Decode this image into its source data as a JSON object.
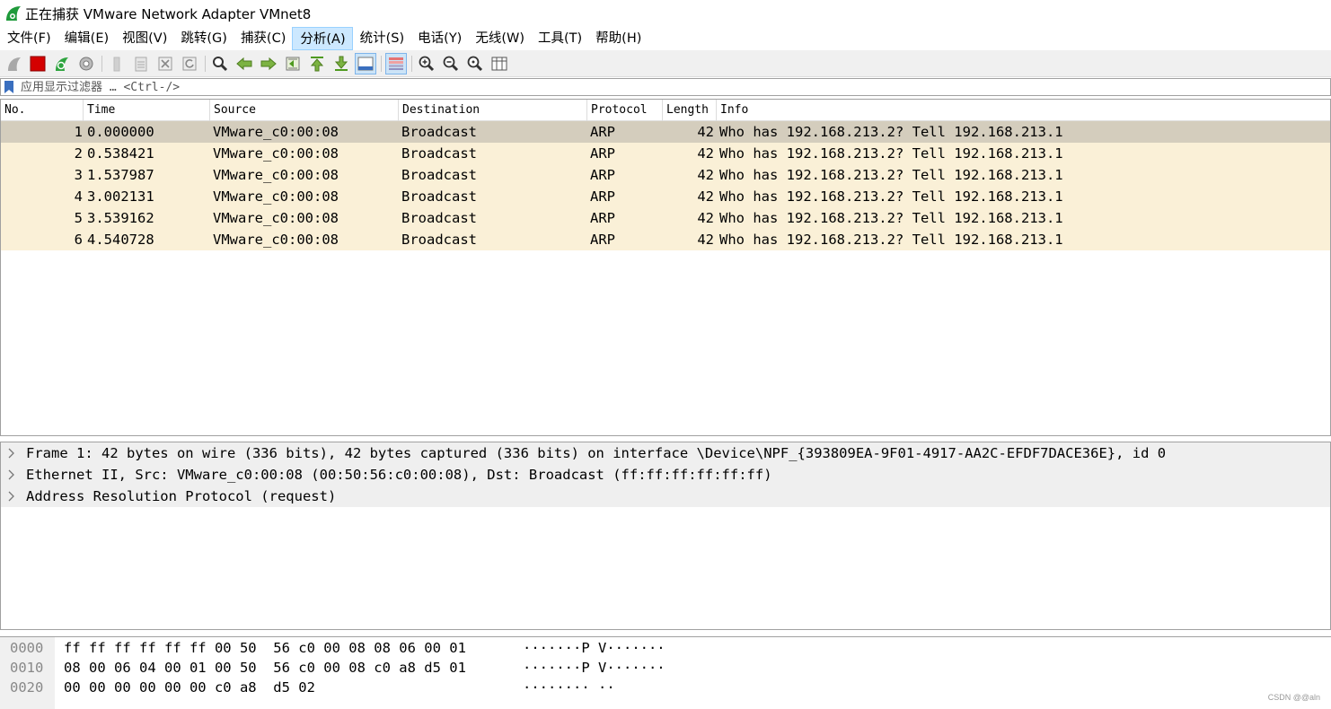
{
  "window": {
    "title": "正在捕获 VMware Network Adapter VMnet8"
  },
  "menu": [
    {
      "label": "文件(F)"
    },
    {
      "label": "编辑(E)"
    },
    {
      "label": "视图(V)"
    },
    {
      "label": "跳转(G)"
    },
    {
      "label": "捕获(C)"
    },
    {
      "label": "分析(A)",
      "active": true
    },
    {
      "label": "统计(S)"
    },
    {
      "label": "电话(Y)"
    },
    {
      "label": "无线(W)"
    },
    {
      "label": "工具(T)"
    },
    {
      "label": "帮助(H)"
    }
  ],
  "toolbar": {
    "icons": [
      "start-capture-icon",
      "stop-capture-icon",
      "restart-capture-icon",
      "capture-options-icon",
      "open-file-icon",
      "save-file-icon",
      "close-file-icon",
      "reload-file-icon",
      "find-packet-icon",
      "go-back-icon",
      "go-forward-icon",
      "go-to-packet-icon",
      "go-first-packet-icon",
      "go-last-packet-icon",
      "auto-scroll-icon",
      "colorize-icon",
      "zoom-in-icon",
      "zoom-out-icon",
      "zoom-normal-icon",
      "resize-columns-icon"
    ]
  },
  "filter": {
    "placeholder": "应用显示过滤器 … <Ctrl-/>",
    "value": ""
  },
  "packet_list": {
    "columns": [
      "No.",
      "Time",
      "Source",
      "Destination",
      "Protocol",
      "Length",
      "Info"
    ],
    "rows": [
      {
        "no": "1",
        "time": "0.000000",
        "source": "VMware_c0:00:08",
        "destination": "Broadcast",
        "protocol": "ARP",
        "length": "42",
        "info": "Who has 192.168.213.2? Tell 192.168.213.1",
        "selected": true
      },
      {
        "no": "2",
        "time": "0.538421",
        "source": "VMware_c0:00:08",
        "destination": "Broadcast",
        "protocol": "ARP",
        "length": "42",
        "info": "Who has 192.168.213.2? Tell 192.168.213.1"
      },
      {
        "no": "3",
        "time": "1.537987",
        "source": "VMware_c0:00:08",
        "destination": "Broadcast",
        "protocol": "ARP",
        "length": "42",
        "info": "Who has 192.168.213.2? Tell 192.168.213.1"
      },
      {
        "no": "4",
        "time": "3.002131",
        "source": "VMware_c0:00:08",
        "destination": "Broadcast",
        "protocol": "ARP",
        "length": "42",
        "info": "Who has 192.168.213.2? Tell 192.168.213.1"
      },
      {
        "no": "5",
        "time": "3.539162",
        "source": "VMware_c0:00:08",
        "destination": "Broadcast",
        "protocol": "ARP",
        "length": "42",
        "info": "Who has 192.168.213.2? Tell 192.168.213.1"
      },
      {
        "no": "6",
        "time": "4.540728",
        "source": "VMware_c0:00:08",
        "destination": "Broadcast",
        "protocol": "ARP",
        "length": "42",
        "info": "Who has 192.168.213.2? Tell 192.168.213.1"
      }
    ]
  },
  "details": [
    "Frame 1: 42 bytes on wire (336 bits), 42 bytes captured (336 bits) on interface \\Device\\NPF_{393809EA-9F01-4917-AA2C-EFDF7DACE36E}, id 0",
    "Ethernet II, Src: VMware_c0:00:08 (00:50:56:c0:00:08), Dst: Broadcast (ff:ff:ff:ff:ff:ff)",
    "Address Resolution Protocol (request)"
  ],
  "bytes": [
    {
      "offset": "0000",
      "hex": "ff ff ff ff ff ff 00 50  56 c0 00 08 08 06 00 01",
      "ascii": "·······P V·······"
    },
    {
      "offset": "0010",
      "hex": "08 00 06 04 00 01 00 50  56 c0 00 08 c0 a8 d5 01",
      "ascii": "·······P V·······"
    },
    {
      "offset": "0020",
      "hex": "00 00 00 00 00 00 c0 a8  d5 02",
      "ascii": "········ ··"
    }
  ],
  "watermark": "CSDN @@aln",
  "colors": {
    "row_bg": "#faf0d7",
    "row_selected": "#d4cdbd",
    "menu_active": "#cce8ff"
  }
}
